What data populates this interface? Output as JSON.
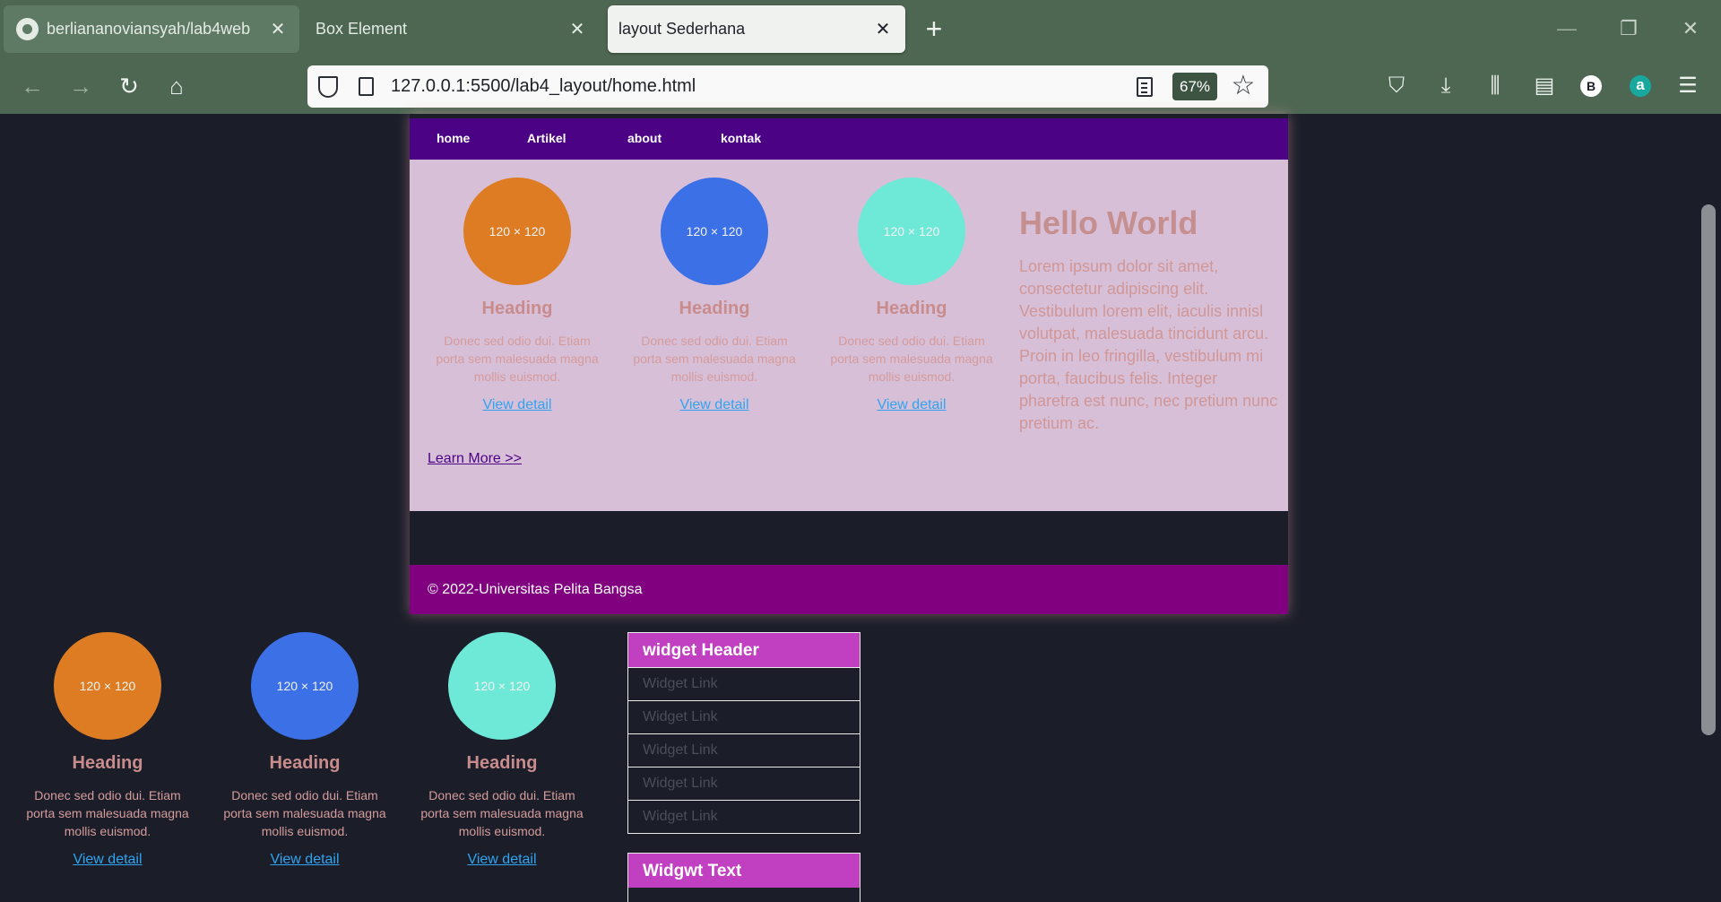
{
  "browser": {
    "tabs": [
      {
        "title": "berliananoviansyah/lab4web",
        "close": "✕"
      },
      {
        "title": "Box Element",
        "close": "✕"
      },
      {
        "title": "layout Sederhana",
        "close": "✕"
      }
    ],
    "new_tab": "+",
    "window_controls": {
      "minimize": "—",
      "restore": "❐",
      "close": "✕"
    },
    "nav": {
      "back": "←",
      "forward": "→",
      "reload": "↻",
      "home": "⌂"
    },
    "url": "127.0.0.1:5500/lab4_layout/home.html",
    "zoom": "67%",
    "toolbar_icons": [
      "pocket-icon",
      "download-icon",
      "library-icon",
      "sidebar-icon",
      "profile-b-icon",
      "extension-a-icon",
      "menu-icon"
    ],
    "profile_letter": "B",
    "extension_letter": "a"
  },
  "page": {
    "nav": [
      "home",
      "Artikel",
      "about",
      "kontak"
    ],
    "placeholder_label": "120 × 120",
    "cards": [
      {
        "heading": "Heading",
        "text": "Donec sed odio dui. Etiam porta sem malesuada magna mollis euismod.",
        "link": "View detail",
        "color": "#dd7c23"
      },
      {
        "heading": "Heading",
        "text": "Donec sed odio dui. Etiam porta sem malesuada magna mollis euismod.",
        "link": "View detail",
        "color": "#3c70e6"
      },
      {
        "heading": "Heading",
        "text": "Donec sed odio dui. Etiam porta sem malesuada magna mollis euismod.",
        "link": "View detail",
        "color": "#6ee8d7"
      }
    ],
    "hero": {
      "title": "Hello World",
      "text": "Lorem ipsum dolor sit amet, consectetur adipiscing elit. Vestibulum lorem elit, iaculis innisl volutpat, malesuada tincidunt arcu. Proin in leo fringilla, vestibulum mi porta, faucibus felis. Integer pharetra est nunc, nec pretium nunc pretium ac."
    },
    "learn_more": "Learn More >>",
    "footer": "© 2022-Universitas Pelita Bangsa",
    "widget": {
      "header": "widget Header",
      "links": [
        "Widget Link",
        "Widget Link",
        "Widget Link",
        "Widget Link",
        "Widget Link"
      ]
    },
    "widget2": {
      "header": "Widgwt Text"
    }
  },
  "colors": {
    "chrome": "#4e6752",
    "nav_bg": "#4b0285",
    "hero_bg": "#d8bfd8",
    "footer_bg": "#800080",
    "widget_head": "#c140c1",
    "page_bg": "#1b1e29"
  }
}
